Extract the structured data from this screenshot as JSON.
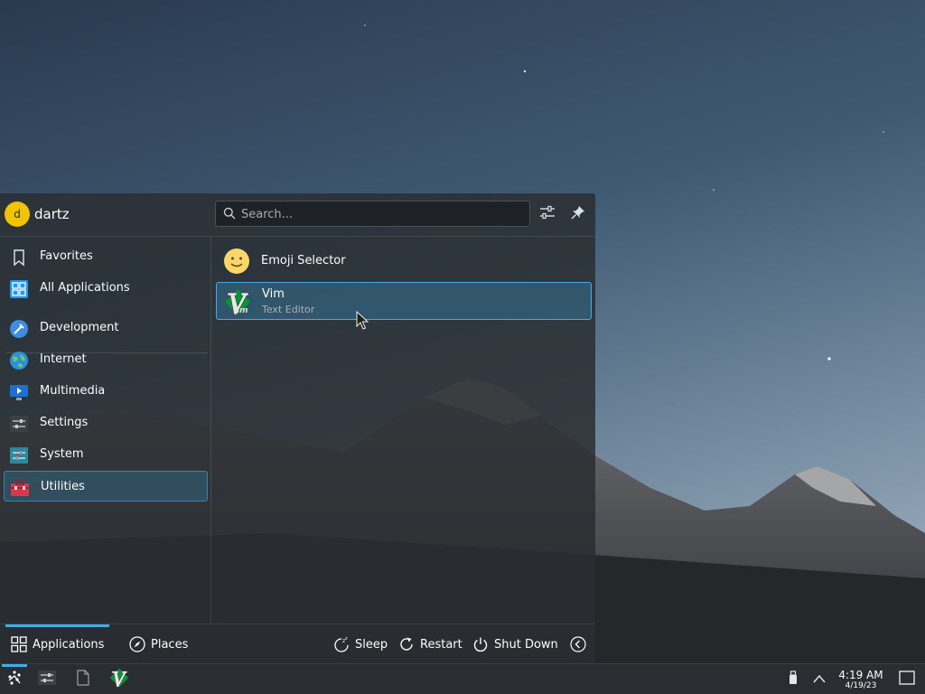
{
  "user": {
    "initial": "d",
    "name": "dartz"
  },
  "search": {
    "placeholder": "Search..."
  },
  "categories": [
    {
      "label": "Favorites",
      "icon": "bookmark-icon"
    },
    {
      "label": "All Applications",
      "icon": "grid-icon"
    },
    {
      "label": "Development",
      "icon": "development-icon"
    },
    {
      "label": "Internet",
      "icon": "globe-icon"
    },
    {
      "label": "Multimedia",
      "icon": "multimedia-icon"
    },
    {
      "label": "Settings",
      "icon": "settings-icon"
    },
    {
      "label": "System",
      "icon": "system-icon"
    },
    {
      "label": "Utilities",
      "icon": "toolbox-icon",
      "selected": true
    }
  ],
  "apps": [
    {
      "name": "Emoji Selector",
      "description": "",
      "icon": "emoji-icon"
    },
    {
      "name": "Vim",
      "description": "Text Editor",
      "icon": "vim-icon",
      "highlighted": true
    }
  ],
  "footer": {
    "tabs": [
      {
        "label": "Applications",
        "icon": "grid-icon",
        "active": true
      },
      {
        "label": "Places",
        "icon": "compass-icon"
      }
    ],
    "actions": [
      {
        "label": "Sleep",
        "icon": "sleep-icon"
      },
      {
        "label": "Restart",
        "icon": "restart-icon"
      },
      {
        "label": "Shut Down",
        "icon": "power-icon"
      }
    ]
  },
  "taskbar": {
    "clock_time": "4:19 AM",
    "clock_date": "4/19/23"
  },
  "colors": {
    "accent": "#3daee9",
    "panel": "#2a2e32"
  }
}
